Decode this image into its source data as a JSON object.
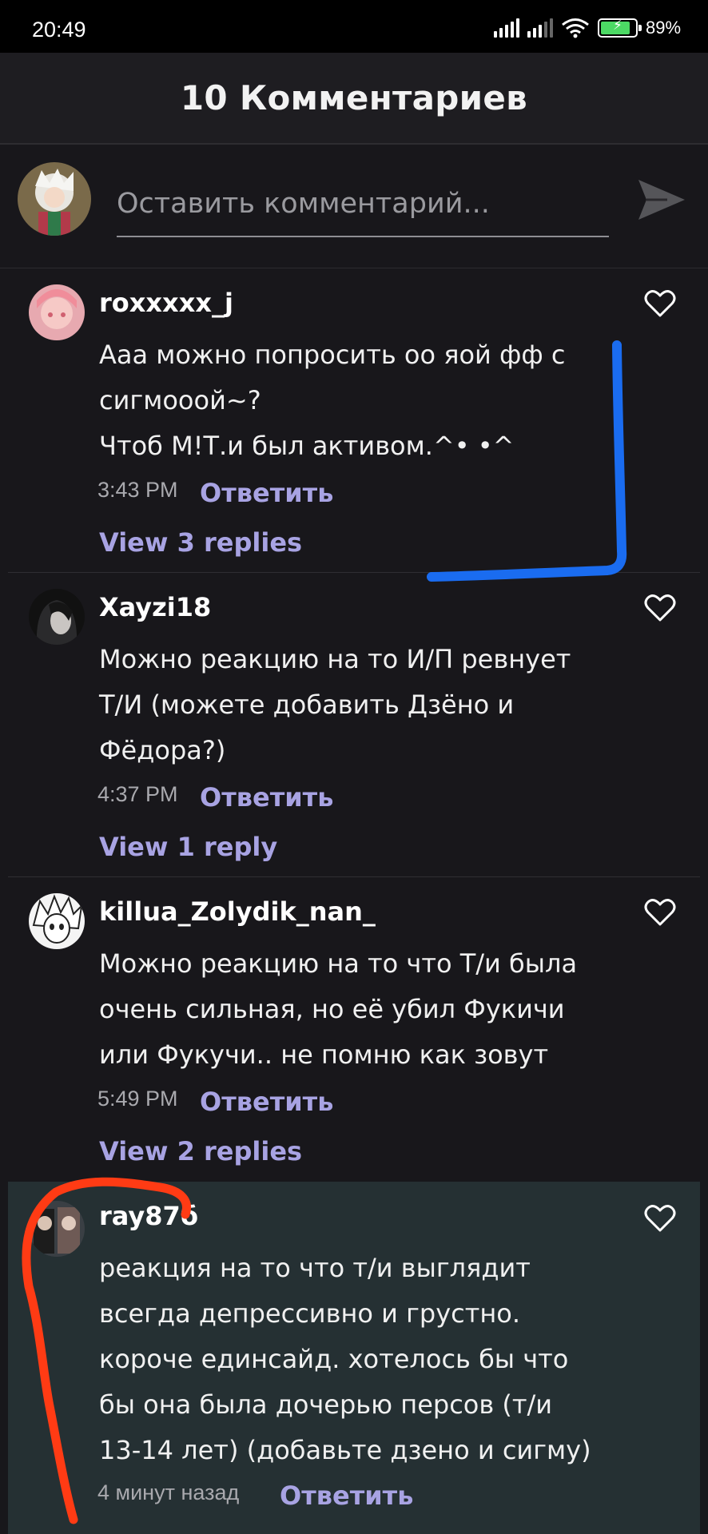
{
  "status_bar": {
    "time": "20:49",
    "battery": "89",
    "battery_level": 0.89
  },
  "header": {
    "title": "10 Комментариев"
  },
  "composer": {
    "placeholder": "Оставить комментарий..."
  },
  "comments": [
    {
      "username": "roxxxxx_j",
      "lines": [
        "Ааа можно попросить оо яой фф с",
        "сигмооой~?",
        "Чтоб М!Т.и был активом.^• •^"
      ],
      "time": "3:43 PM",
      "reply_label": "Ответить",
      "view_replies": "View 3 replies"
    },
    {
      "username": "Xayzi18",
      "lines": [
        "Можно реакцию на то И/П ревнует",
        "Т/И (можете добавить Дзёно и",
        "Фёдора?)"
      ],
      "time": "4:37 PM",
      "reply_label": "Ответить",
      "view_replies": "View 1 reply"
    },
    {
      "username": "killua_Zolydik_nan_",
      "lines": [
        "Можно реакцию на то что Т/и была",
        "очень сильная, но её убил Фукичи",
        "или Фукучи.. не помню как зовут"
      ],
      "time": "5:49 PM",
      "reply_label": "Ответить",
      "view_replies": "View 2 replies"
    },
    {
      "username": "ray87б",
      "lines": [
        "реакция на то что т/и выглядит",
        "всегда депрессивно и грустно.",
        "короче единсайд. хотелось бы что",
        "бы она была дочерью персов (т/и",
        "13-14 лет) (добавьте дзено и сигму)"
      ],
      "time": "4 минут назад",
      "reply_label": "Ответить"
    }
  ],
  "colors": {
    "accent": "#a8a3e3",
    "annotation_blue": "#1a6cf0",
    "annotation_red": "#ff3b14",
    "highlight_bg": "#253033"
  }
}
